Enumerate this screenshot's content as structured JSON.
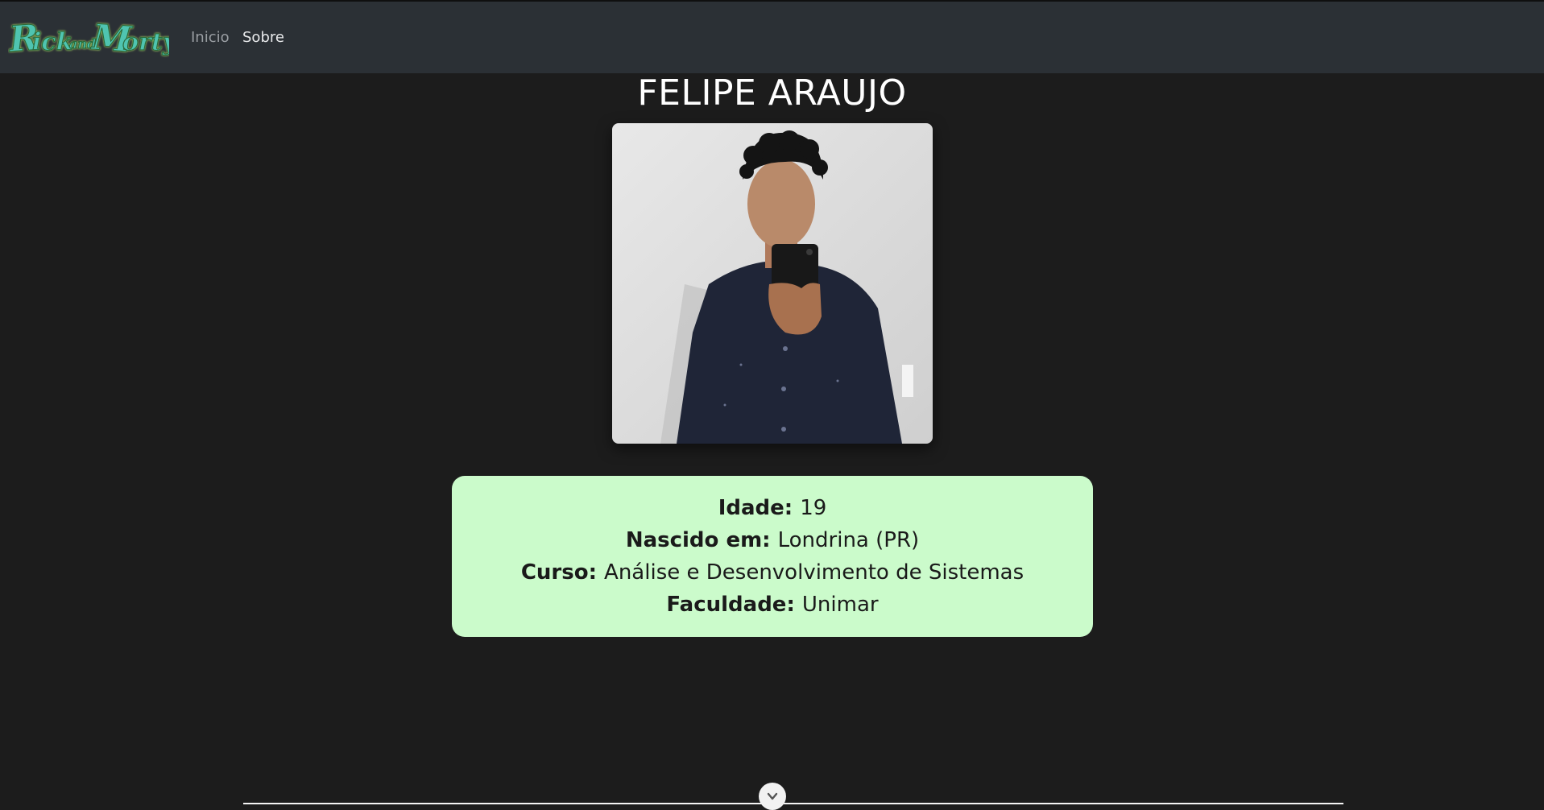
{
  "navbar": {
    "brand_logo_text": "Rick and Morty",
    "links": [
      {
        "label": "Inicio"
      },
      {
        "label": "Sobre"
      }
    ]
  },
  "profile": {
    "name": "FELIPE ARAUJO",
    "details": [
      {
        "label": "Idade:",
        "value": "19"
      },
      {
        "label": "Nascido em:",
        "value": "Londrina (PR)"
      },
      {
        "label": "Curso:",
        "value": "Análise e Desenvolvimento de Sistemas"
      },
      {
        "label": "Faculdade:",
        "value": "Unimar"
      }
    ]
  },
  "colors": {
    "navbar_bg": "#2b3035",
    "page_bg": "#1c1c1c",
    "card_bg": "#cbfbcb",
    "logo_green": "#5ec8a6"
  },
  "icons": {
    "scroll": "chevron-down-icon"
  }
}
